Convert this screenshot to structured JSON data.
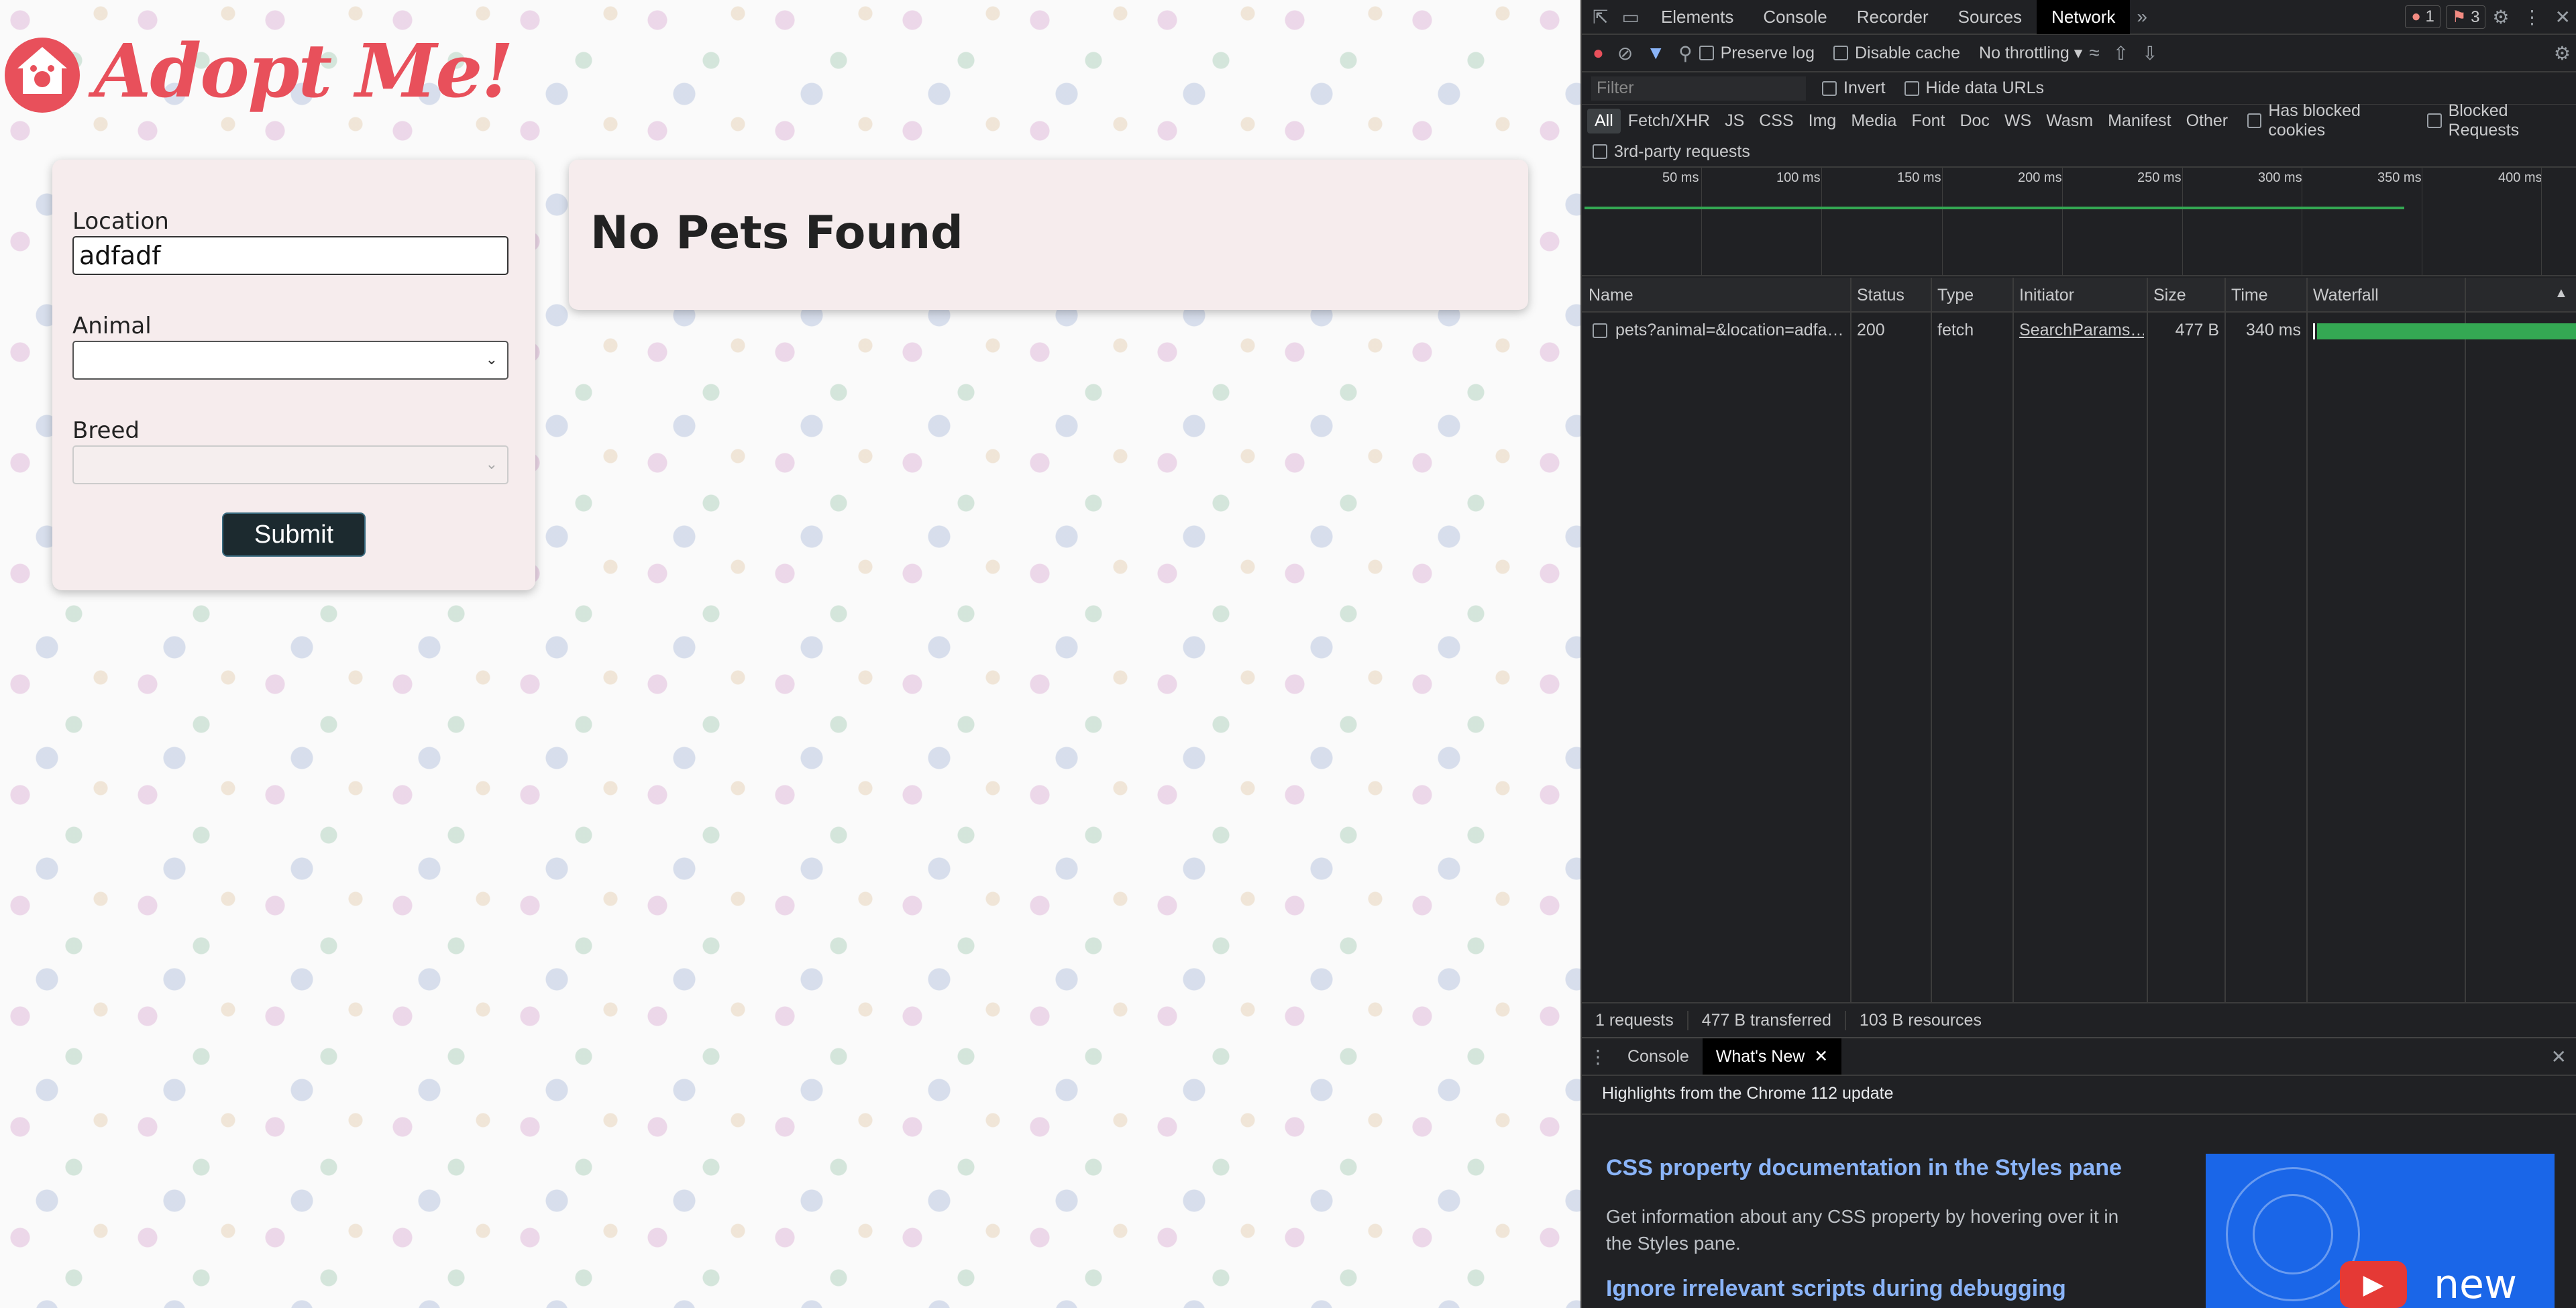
{
  "app": {
    "logo_text": "Adopt Me!",
    "form": {
      "location_label": "Location",
      "location_value": "adfadf",
      "animal_label": "Animal",
      "animal_value": "",
      "breed_label": "Breed",
      "breed_value": "",
      "submit_label": "Submit"
    },
    "results": {
      "empty_message": "No Pets Found"
    },
    "colors": {
      "brand": "#e8505b",
      "card": "#f6eced",
      "button": "#1c2a2f"
    }
  },
  "devtools": {
    "tabs": [
      "Elements",
      "Console",
      "Recorder",
      "Sources",
      "Network"
    ],
    "active_tab": "Network",
    "errors_count": "1",
    "issues_count": "3",
    "toolbar": {
      "preserve_log": "Preserve log",
      "disable_cache": "Disable cache",
      "throttling": "No throttling"
    },
    "filter": {
      "placeholder": "Filter",
      "invert": "Invert",
      "hide_data_urls": "Hide data URLs"
    },
    "type_filters": [
      "All",
      "Fetch/XHR",
      "JS",
      "CSS",
      "Img",
      "Media",
      "Font",
      "Doc",
      "WS",
      "Wasm",
      "Manifest",
      "Other"
    ],
    "has_blocked_cookies": "Has blocked cookies",
    "blocked_requests": "Blocked Requests",
    "third_party": "3rd-party requests",
    "timeline_ticks": [
      "50 ms",
      "100 ms",
      "150 ms",
      "200 ms",
      "250 ms",
      "300 ms",
      "350 ms",
      "400 ms"
    ],
    "columns": [
      "Name",
      "Status",
      "Type",
      "Initiator",
      "Size",
      "Time",
      "Waterfall"
    ],
    "requests": [
      {
        "name": "pets?animal=&location=adfa…",
        "status": "200",
        "type": "fetch",
        "initiator": "SearchParams…",
        "size": "477 B",
        "time": "340 ms"
      }
    ],
    "status_bar": {
      "requests": "1 requests",
      "transferred": "477 B transferred",
      "resources": "103 B resources"
    },
    "drawer": {
      "tabs": [
        "Console",
        "What's New"
      ],
      "highlights": "Highlights from the Chrome 112 update",
      "item1_title": "CSS property documentation in the Styles pane",
      "item1_desc": "Get information about any CSS property by hovering over it in the Styles pane.",
      "item2_title": "Ignore irrelevant scripts during debugging",
      "image_text": "new"
    }
  }
}
